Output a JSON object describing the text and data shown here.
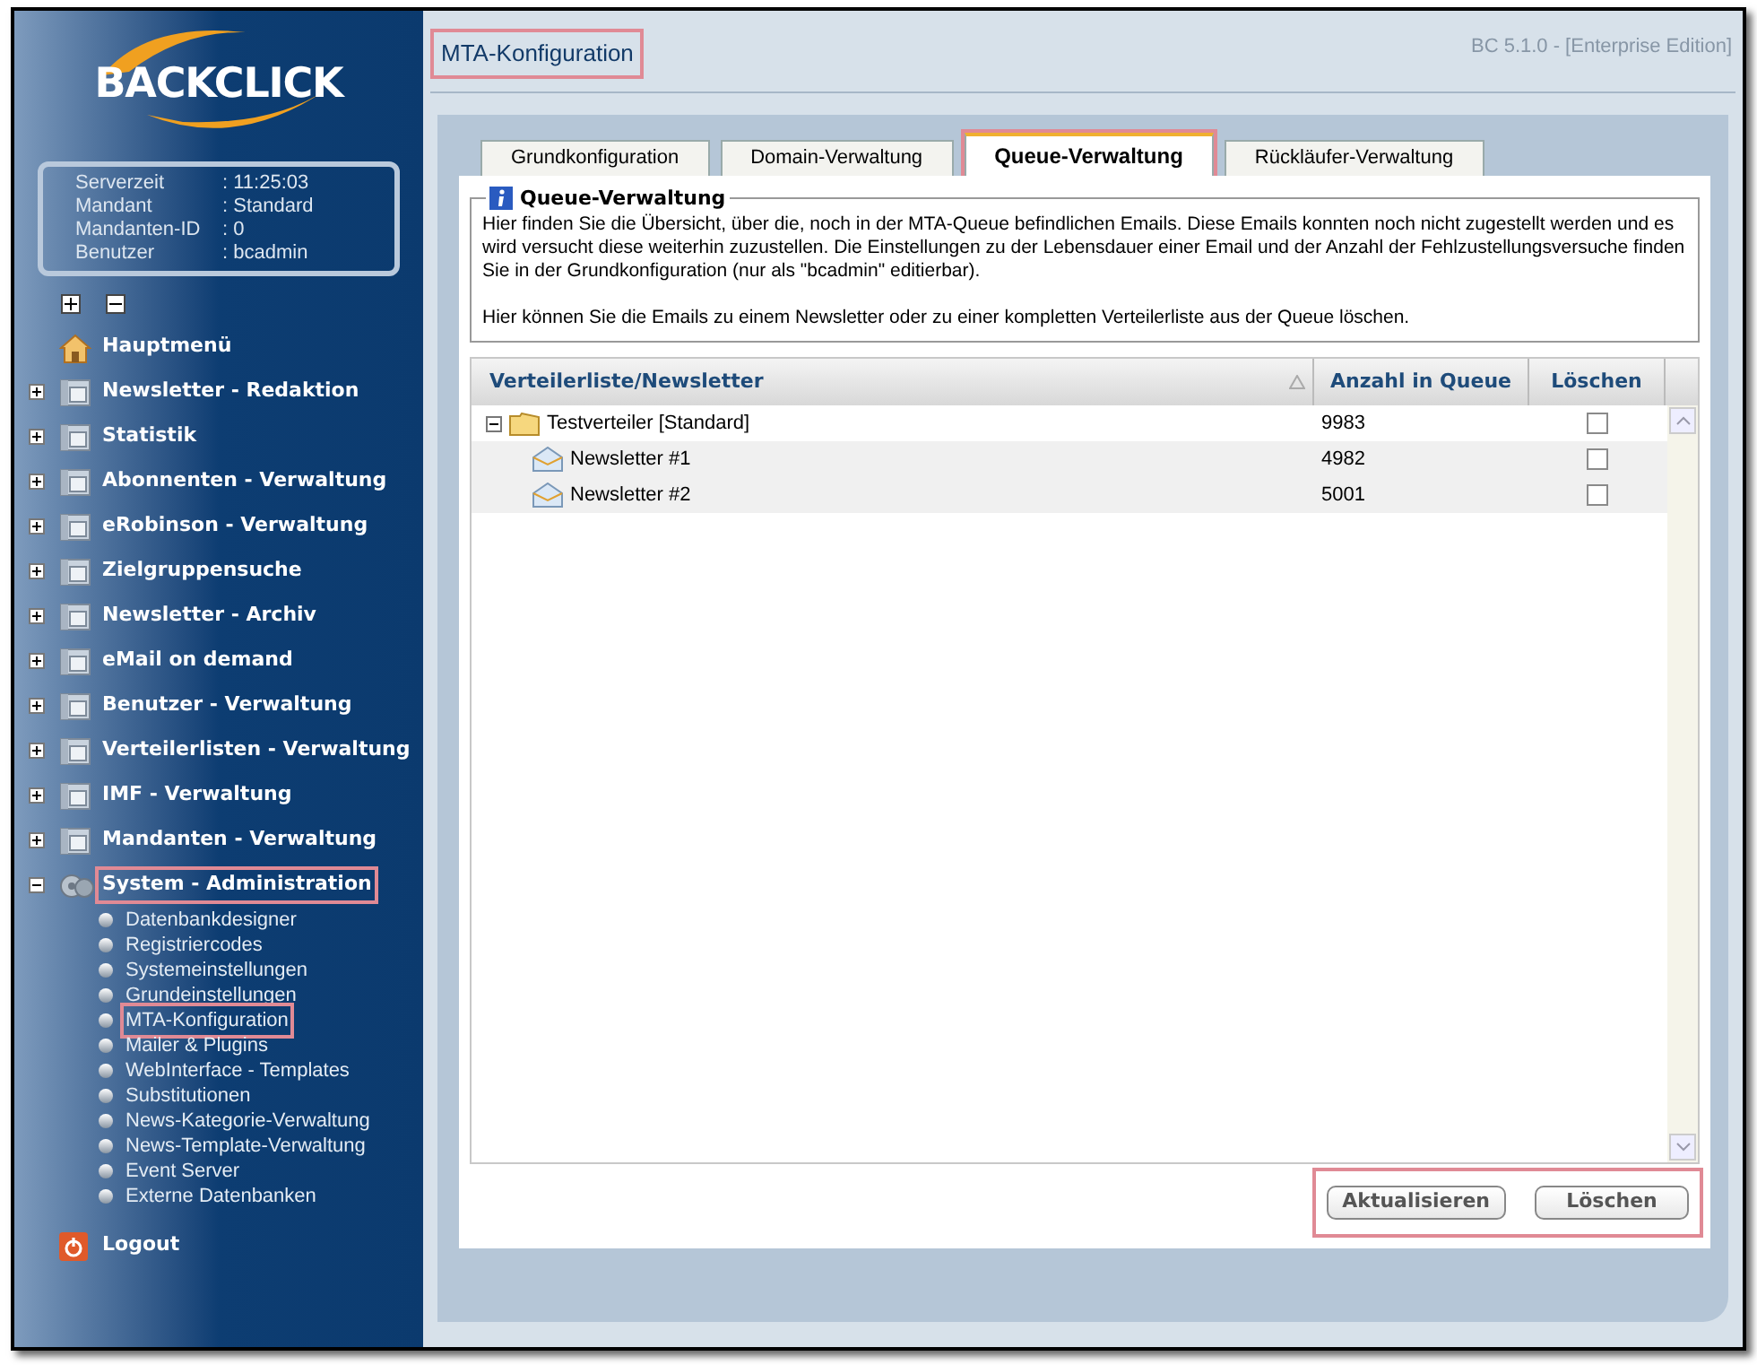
{
  "logo": {
    "text": "BACKCLICK"
  },
  "server_info": [
    {
      "label": "Serverzeit",
      "value": ": 11:25:03"
    },
    {
      "label": "Mandant",
      "value": ": Standard"
    },
    {
      "label": "Mandanten-ID",
      "value": ": 0"
    },
    {
      "label": "Benutzer",
      "value": ": bcadmin"
    }
  ],
  "menu": [
    {
      "label": "Hauptmenü",
      "kind": "home",
      "annotated": false
    },
    {
      "label": "Newsletter - Redaktion",
      "kind": "folder",
      "expanded": false,
      "annotated": false
    },
    {
      "label": "Statistik",
      "kind": "folder",
      "expanded": false,
      "annotated": false
    },
    {
      "label": "Abonnenten - Verwaltung",
      "kind": "folder",
      "expanded": false,
      "annotated": false
    },
    {
      "label": "eRobinson - Verwaltung",
      "kind": "folder",
      "expanded": false,
      "annotated": false
    },
    {
      "label": "Zielgruppensuche",
      "kind": "folder",
      "expanded": false,
      "annotated": false
    },
    {
      "label": "Newsletter - Archiv",
      "kind": "folder",
      "expanded": false,
      "annotated": false
    },
    {
      "label": "eMail on demand",
      "kind": "folder",
      "expanded": false,
      "annotated": false
    },
    {
      "label": "Benutzer - Verwaltung",
      "kind": "folder",
      "expanded": false,
      "annotated": false
    },
    {
      "label": "Verteilerlisten - Verwaltung",
      "kind": "folder",
      "expanded": false,
      "annotated": false
    },
    {
      "label": "IMF - Verwaltung",
      "kind": "folder",
      "expanded": false,
      "annotated": false
    },
    {
      "label": "Mandanten - Verwaltung",
      "kind": "folder",
      "expanded": false,
      "annotated": false
    },
    {
      "label": "System - Administration",
      "kind": "system",
      "expanded": true,
      "annotated": true,
      "children": [
        {
          "label": "Datenbankdesigner",
          "annotated": false
        },
        {
          "label": "Registriercodes",
          "annotated": false
        },
        {
          "label": "Systemeinstellungen",
          "annotated": false
        },
        {
          "label": "Grundeinstellungen",
          "annotated": false
        },
        {
          "label": "MTA-Konfiguration",
          "annotated": true
        },
        {
          "label": "Mailer & Plugins",
          "annotated": false
        },
        {
          "label": "WebInterface - Templates",
          "annotated": false
        },
        {
          "label": "Substitutionen",
          "annotated": false
        },
        {
          "label": "News-Kategorie-Verwaltung",
          "annotated": false
        },
        {
          "label": "News-Template-Verwaltung",
          "annotated": false
        },
        {
          "label": "Event Server",
          "annotated": false
        },
        {
          "label": "Externe Datenbanken",
          "annotated": false
        }
      ]
    },
    {
      "label": "Logout",
      "kind": "logout",
      "annotated": false
    }
  ],
  "page_title": {
    "text": "MTA-Konfiguration",
    "annotated": true
  },
  "version": "BC 5.1.0 - [Enterprise Edition]",
  "tabs": [
    {
      "label": "Grundkonfiguration",
      "selected": false
    },
    {
      "label": "Domain-Verwaltung",
      "selected": false
    },
    {
      "label": "Queue-Verwaltung",
      "selected": true
    },
    {
      "label": "Rückläufer-Verwaltung",
      "selected": false
    }
  ],
  "section": {
    "title": "Queue-Verwaltung",
    "paragraphs": [
      "Hier finden Sie die Übersicht, über die, noch in der MTA-Queue befindlichen Emails. Diese Emails konnten noch nicht zugestellt werden und es wird versucht diese weiterhin zuzustellen. Die Einstellungen zu der Lebensdauer einer Email und der Anzahl der Fehlzustellungsversuche finden Sie in der Grundkonfiguration (nur als \"bcadmin\" editierbar).",
      "Hier können Sie die Emails zu einem Newsletter oder zu einer kompletten Verteilerliste aus der Queue löschen."
    ]
  },
  "table": {
    "columns": [
      "Verteilerliste/Newsletter",
      "Anzahl in Queue",
      "Löschen"
    ],
    "rows": [
      {
        "name": "Testverteiler [Standard]",
        "count": "9983",
        "checked": false,
        "expanded": true,
        "children": [
          {
            "name": "Newsletter #1",
            "count": "4982",
            "checked": false
          },
          {
            "name": "Newsletter #2",
            "count": "5001",
            "checked": false
          }
        ]
      }
    ]
  },
  "buttons": {
    "annotated": true,
    "items": [
      "Aktualisieren",
      "Löschen"
    ]
  }
}
